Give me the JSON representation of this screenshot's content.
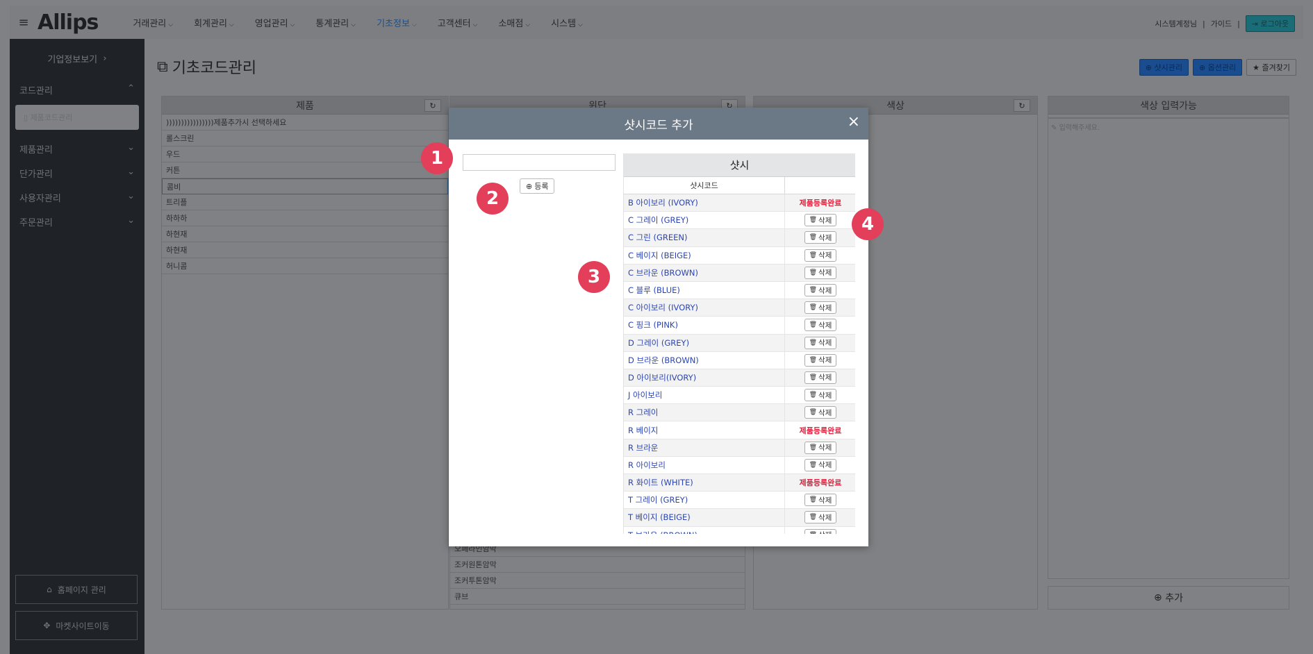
{
  "topbar": {
    "logo": "Allips",
    "menu": [
      {
        "label": "거래관리"
      },
      {
        "label": "회계관리"
      },
      {
        "label": "영업관리"
      },
      {
        "label": "통계관리"
      },
      {
        "label": "기초정보"
      },
      {
        "label": "고객센터"
      },
      {
        "label": "소매점"
      },
      {
        "label": "시스템"
      }
    ],
    "user": "시스템계정님",
    "guide": "가이드",
    "logout": "로그아웃"
  },
  "sidebar": {
    "company": "기업정보보기",
    "code_group": "코드관리",
    "active_item": "제품코드관리",
    "groups": [
      "제품관리",
      "단가관리",
      "사용자관리",
      "주문관리"
    ],
    "homepage_btn": "홈페이지 관리",
    "market_btn": "마켓사이트이동"
  },
  "main": {
    "title": "기초코드관리",
    "btn_sash": "샷시관리",
    "btn_option": "옵션관리",
    "btn_favorite": "즐겨찾기",
    "columns": {
      "product": "제품",
      "wid": "윈단",
      "color": "색상",
      "color_input": "색상 입력가능"
    },
    "product_rows": [
      "))))))))))))))))제품추가시 선택하세요",
      "롤스크린",
      "우드",
      "커튼",
      "콤비",
      "트리플",
      "하하하",
      "하현재",
      "하현재",
      "허니콤"
    ],
    "wid_rows_bottom": [
      "오페라인암막",
      "조커원톤암막",
      "조커투톤암막",
      "큐브"
    ],
    "color_input_placeholder": "입력해주세요.",
    "add_label": "추가"
  },
  "modal": {
    "title": "샷시코드 추가",
    "register_label": "등록",
    "panel_title": "샷시",
    "col_code": "샷시코드",
    "rows": [
      {
        "name": "B 아이보리 (IVORY)",
        "status": "제품등록완료"
      },
      {
        "name": "C 그레이 (GREY)",
        "status": "삭제"
      },
      {
        "name": "C 그린 (GREEN)",
        "status": "삭제"
      },
      {
        "name": "C 베이지 (BEIGE)",
        "status": "삭제"
      },
      {
        "name": "C 브라운 (BROWN)",
        "status": "삭제"
      },
      {
        "name": "C 블루 (BLUE)",
        "status": "삭제"
      },
      {
        "name": "C 아이보리 (IVORY)",
        "status": "삭제"
      },
      {
        "name": "C 핑크 (PINK)",
        "status": "삭제"
      },
      {
        "name": "D 그레이 (GREY)",
        "status": "삭제"
      },
      {
        "name": "D 브라운 (BROWN)",
        "status": "삭제"
      },
      {
        "name": "D 아이보리(IVORY)",
        "status": "삭제"
      },
      {
        "name": "J 아이보리",
        "status": "삭제"
      },
      {
        "name": "R 그레이",
        "status": "삭제"
      },
      {
        "name": "R 베이지",
        "status": "제품등록완료"
      },
      {
        "name": "R 브라운",
        "status": "삭제"
      },
      {
        "name": "R 아이보리",
        "status": "삭제"
      },
      {
        "name": "R 화이트 (WHITE)",
        "status": "제품등록완료"
      },
      {
        "name": "T 그레이 (GREY)",
        "status": "삭제"
      },
      {
        "name": "T 베이지 (BEIGE)",
        "status": "삭제"
      },
      {
        "name": "T 브라운 (BROWN)",
        "status": "삭제"
      }
    ]
  },
  "markers": [
    "1",
    "2",
    "3",
    "4"
  ],
  "colors": {
    "accent": "#e33e5a",
    "modal_header": "#6b7886",
    "link": "#2a44b5",
    "done": "#e0203c"
  }
}
